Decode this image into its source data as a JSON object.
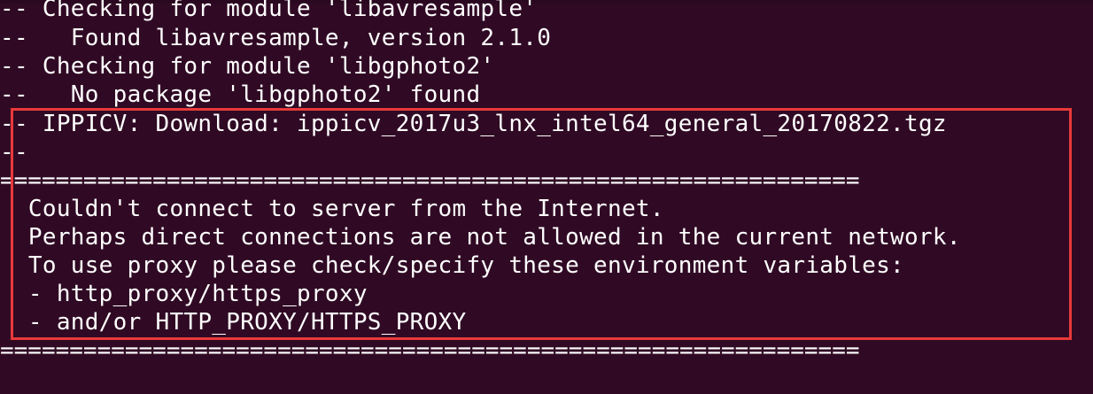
{
  "terminal": {
    "lines": [
      "-- Checking for module 'libavresample'",
      "--   Found libavresample, version 2.1.0",
      "-- Checking for module 'libgphoto2'",
      "--   No package 'libgphoto2' found",
      "-- IPPICV: Download: ippicv_2017u3_lnx_intel64_general_20170822.tgz",
      "--",
      "==============================================================",
      "  Couldn't connect to server from the Internet.",
      "  Perhaps direct connections are not allowed in the current network.",
      "  To use proxy please check/specify these environment variables:",
      "  - http_proxy/https_proxy",
      "  - and/or HTTP_PROXY/HTTPS_PROXY",
      "=============================================================="
    ]
  },
  "colors": {
    "background": "#300a24",
    "text": "#ffffff",
    "highlight_border": "#e8393a"
  }
}
